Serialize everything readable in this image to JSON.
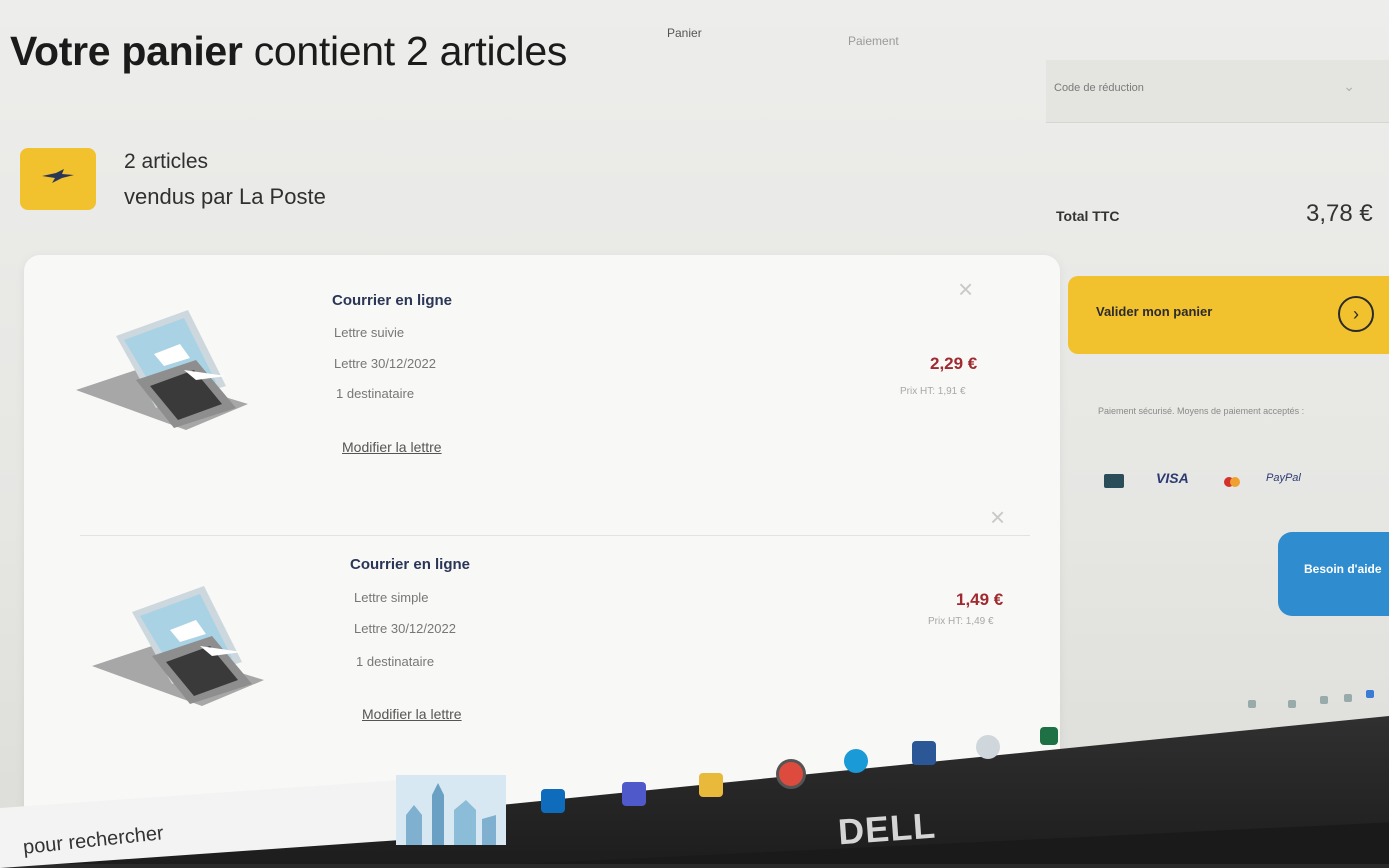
{
  "steps": {
    "panier": "Panier",
    "paiement": "Paiement"
  },
  "header": {
    "title_bold": "Votre panier",
    "title_rest": "contient 2 articles"
  },
  "seller": {
    "count": "2 articles",
    "name": "vendus par La Poste",
    "logo_icon": "la-poste-bird-logo"
  },
  "items": [
    {
      "title": "Courrier en ligne",
      "type": "Lettre suivie",
      "date": "Lettre 30/12/2022",
      "recipients": "1 destinataire",
      "modify": "Modifier la lettre",
      "price": "2,29 €",
      "price_ht": "Prix HT: 1,91 €",
      "close": "×",
      "illustration_icon": "laptop-letter-icon"
    },
    {
      "title": "Courrier en ligne",
      "type": "Lettre simple",
      "date": "Lettre 30/12/2022",
      "recipients": "1 destinataire",
      "modify": "Modifier la lettre",
      "price": "1,49 €",
      "price_ht": "Prix HT: 1,49 €",
      "close": "×",
      "illustration_icon": "laptop-letter-icon"
    }
  ],
  "sidebar": {
    "promo_label": "Code de réduction",
    "total_label": "Total TTC",
    "total_value": "3,78 €",
    "validate_label": "Valider mon panier",
    "validate_icon": "arrow-right-circle-icon",
    "payment_note": "Paiement sécurisé. Moyens de paiement acceptés :",
    "payment_methods": [
      "card",
      "VISA",
      "mastercard",
      "PayPal",
      "apple-pay"
    ],
    "visa_label": "VISA",
    "paypal_label": "PayPal",
    "help_label": "Besoin d'aide"
  },
  "taskbar": {
    "search_placeholder": "pour rechercher",
    "apps": [
      "outlook-icon",
      "teams-icon",
      "file-explorer-icon",
      "chrome-icon",
      "edge-icon",
      "word-icon",
      "settings-icon",
      "excel-icon"
    ],
    "brand": "DELL"
  },
  "colors": {
    "accent_yellow": "#f2c22e",
    "price_red": "#a02a30",
    "title_navy": "#2b3656",
    "help_blue": "#2e8ccf"
  }
}
